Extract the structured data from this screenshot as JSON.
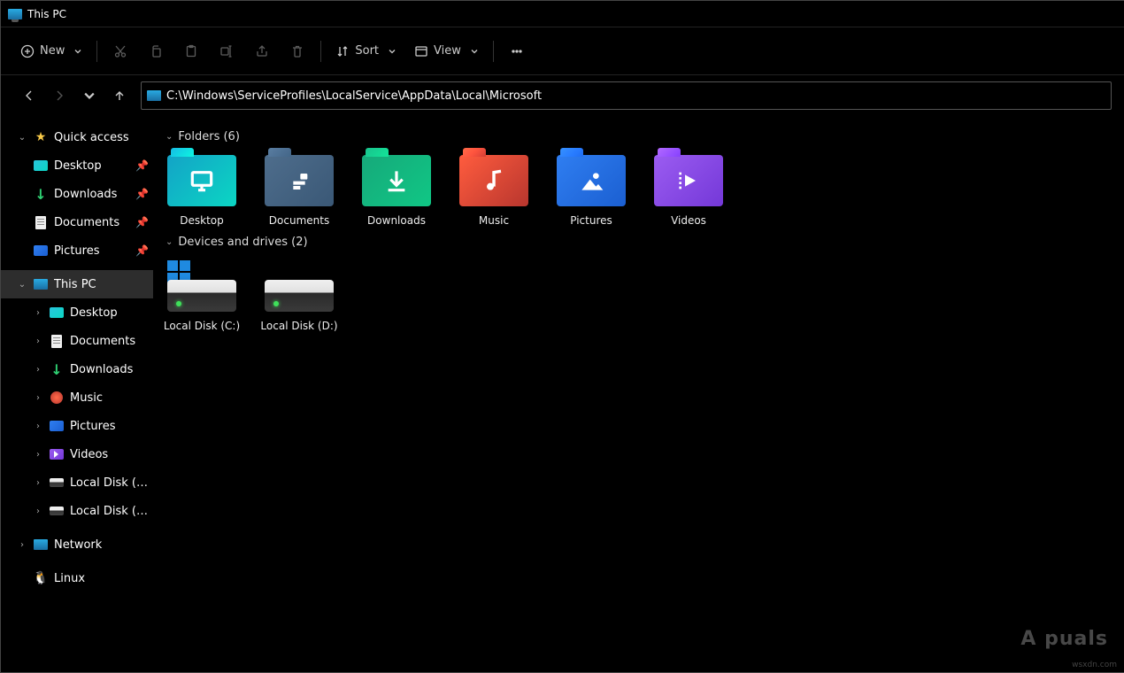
{
  "window": {
    "title": "This PC"
  },
  "toolbar": {
    "new_label": "New",
    "sort_label": "Sort",
    "view_label": "View"
  },
  "address": {
    "value": "C:\\Windows\\ServiceProfiles\\LocalService\\AppData\\Local\\Microsoft"
  },
  "sidebar": {
    "quick_access": {
      "label": "Quick access",
      "items": [
        {
          "label": "Desktop",
          "icon": "desktop",
          "pinned": true
        },
        {
          "label": "Downloads",
          "icon": "downloads",
          "pinned": true
        },
        {
          "label": "Documents",
          "icon": "documents",
          "pinned": true
        },
        {
          "label": "Pictures",
          "icon": "pictures",
          "pinned": true
        }
      ]
    },
    "this_pc": {
      "label": "This PC",
      "items": [
        {
          "label": "Desktop",
          "icon": "desktop"
        },
        {
          "label": "Documents",
          "icon": "documents"
        },
        {
          "label": "Downloads",
          "icon": "downloads"
        },
        {
          "label": "Music",
          "icon": "music"
        },
        {
          "label": "Pictures",
          "icon": "pictures"
        },
        {
          "label": "Videos",
          "icon": "videos"
        },
        {
          "label": "Local Disk (C:)",
          "icon": "drive"
        },
        {
          "label": "Local Disk (D:)",
          "icon": "drive"
        }
      ]
    },
    "network": {
      "label": "Network"
    },
    "linux": {
      "label": "Linux"
    }
  },
  "groups": {
    "folders": {
      "header": "Folders (6)",
      "items": [
        {
          "label": "Desktop",
          "kind": "desktop"
        },
        {
          "label": "Documents",
          "kind": "documents"
        },
        {
          "label": "Downloads",
          "kind": "downloads"
        },
        {
          "label": "Music",
          "kind": "music"
        },
        {
          "label": "Pictures",
          "kind": "pictures"
        },
        {
          "label": "Videos",
          "kind": "videos"
        }
      ]
    },
    "drives": {
      "header": "Devices and drives (2)",
      "items": [
        {
          "label": "Local Disk (C:)",
          "system": true
        },
        {
          "label": "Local Disk (D:)",
          "system": false
        }
      ]
    }
  },
  "watermark": {
    "brand": "A  puals",
    "site": "wsxdn.com"
  }
}
